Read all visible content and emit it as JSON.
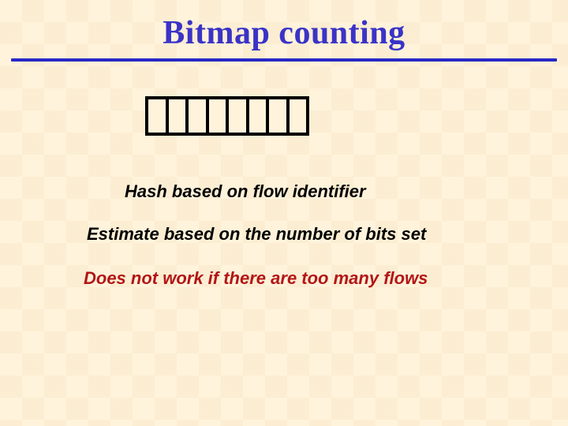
{
  "colors": {
    "title_color": "#3a33c7",
    "rule_color": "#2828c7",
    "warning_color": "#b31616"
  },
  "bitmap": {
    "cell_count": 8
  },
  "title": "Bitmap counting",
  "line1": "Hash based on flow identifier",
  "line2": "Estimate based on the number of bits set",
  "line3": "Does not work if there are too many flows"
}
